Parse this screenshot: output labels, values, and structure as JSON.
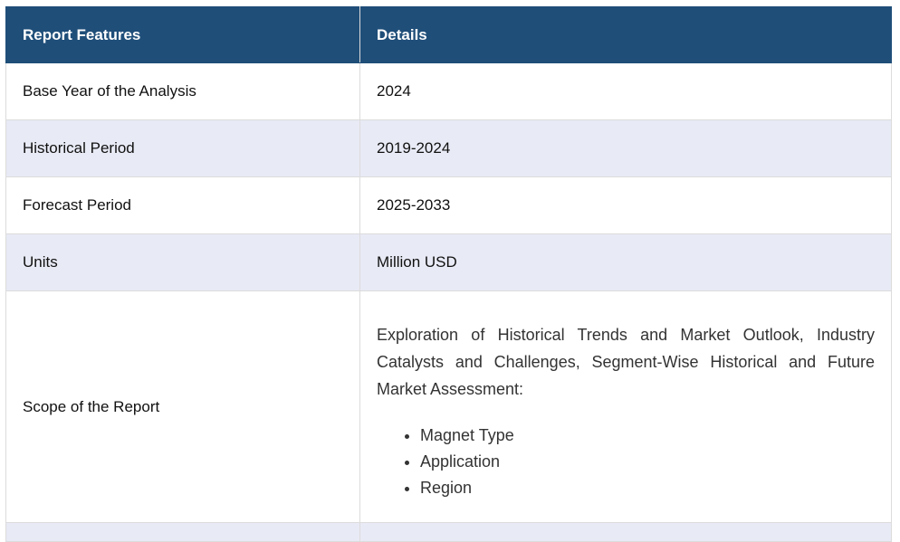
{
  "table": {
    "headers": {
      "feature": "Report Features",
      "details": "Details"
    },
    "rows": [
      {
        "feature": "Base Year of the Analysis",
        "details": "2024"
      },
      {
        "feature": "Historical Period",
        "details": "2019-2024"
      },
      {
        "feature": "Forecast Period",
        "details": "2025-2033"
      },
      {
        "feature": "Units",
        "details": "Million USD"
      }
    ],
    "scope": {
      "feature": "Scope of the Report",
      "text": "Exploration of Historical Trends and Market Outlook, Industry Catalysts and Challenges, Segment-Wise Historical and Future Market Assessment:",
      "items": [
        "Magnet Type",
        "Application",
        "Region"
      ]
    }
  },
  "colors": {
    "header_bg": "#1f4e79",
    "header_text": "#ffffff",
    "alt_row_bg": "#e8eaf5",
    "border": "#dcdcdc"
  }
}
